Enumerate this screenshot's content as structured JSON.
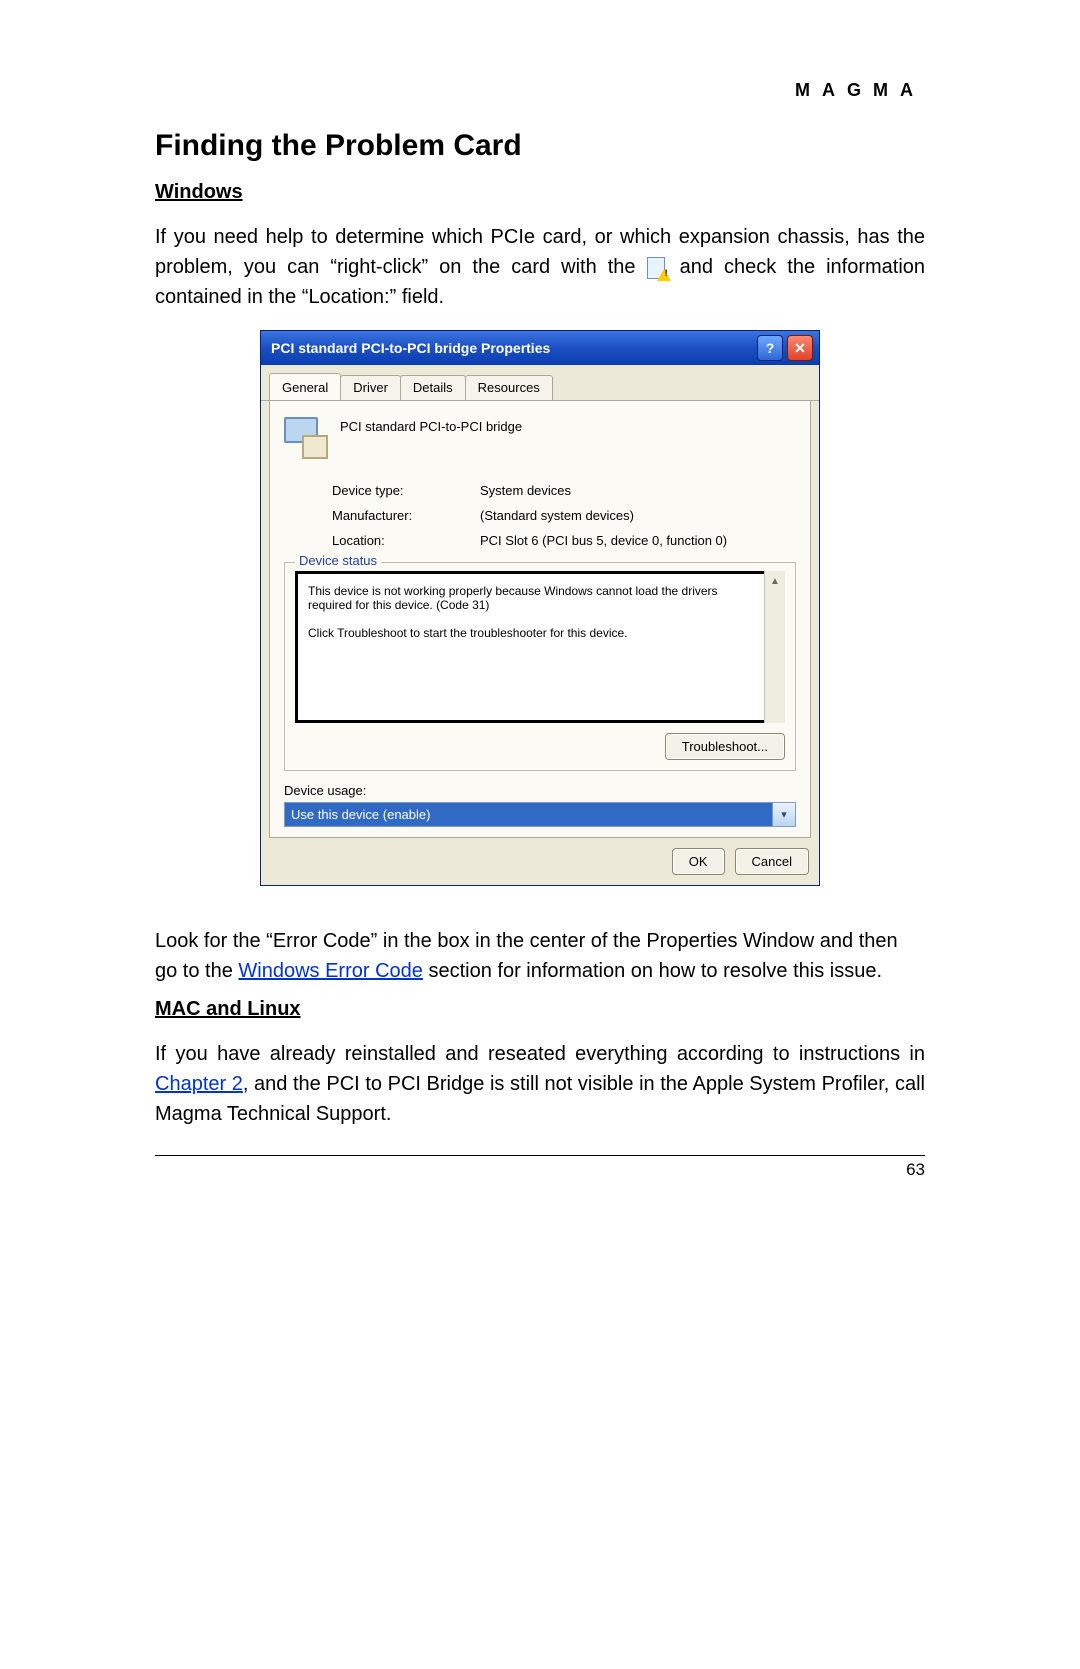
{
  "brand": "MAGMA",
  "heading": "Finding the Problem Card",
  "sections": {
    "windows": {
      "title": "Windows",
      "p1a": "If you need help to determine which PCIe card, or which expansion chassis, has the problem, you can “right-click” on the card with the",
      "p1b": "and check the information contained in the “Location:” field.",
      "p2a": "Look for the “Error Code” in the box in the center of the Properties Window and then go to the ",
      "p2link": "Windows Error Code",
      "p2b": " section for information on how to resolve this issue."
    },
    "mac": {
      "title": "MAC and Linux",
      "p1a": "If you have already reinstalled and reseated everything according to instructions in ",
      "p1link": "Chapter 2",
      "p1b": ", and the PCI to PCI Bridge is still not visible in the Apple System Profiler, call Magma Technical Support."
    }
  },
  "dialog": {
    "title": "PCI standard PCI-to-PCI bridge Properties",
    "help_label": "?",
    "close_label": "✕",
    "tabs": {
      "general": "General",
      "driver": "Driver",
      "details": "Details",
      "resources": "Resources"
    },
    "device_name": "PCI standard PCI-to-PCI bridge",
    "labels": {
      "device_type": "Device type:",
      "manufacturer": "Manufacturer:",
      "location": "Location:"
    },
    "values": {
      "device_type": "System devices",
      "manufacturer": "(Standard system devices)",
      "location": "PCI Slot 6 (PCI bus 5, device 0, function 0)"
    },
    "status_legend": "Device status",
    "status_text1": "This device is not working properly because Windows cannot load the drivers required for this device. (Code 31)",
    "status_text2": "Click Troubleshoot to start the troubleshooter for this device.",
    "troubleshoot": "Troubleshoot...",
    "usage_label": "Device usage:",
    "usage_value": "Use this device (enable)",
    "ok": "OK",
    "cancel": "Cancel"
  },
  "page_number": "63"
}
